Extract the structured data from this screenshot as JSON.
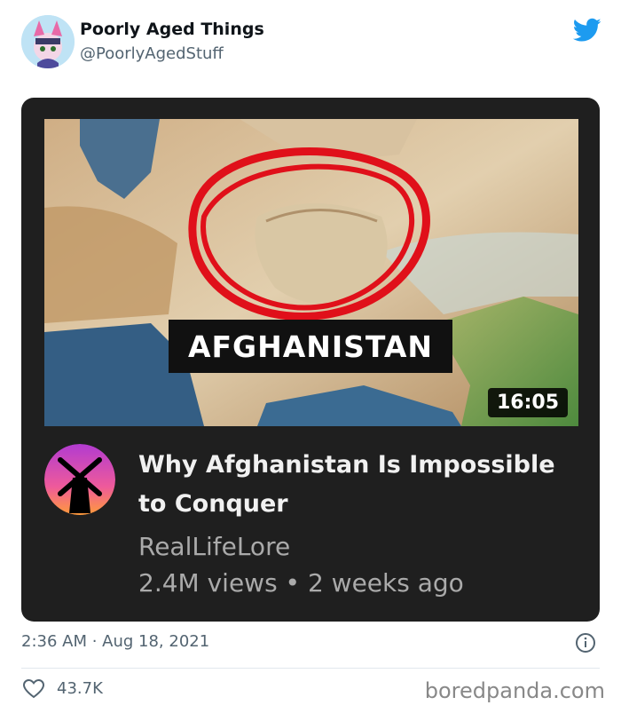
{
  "author": {
    "display_name": "Poorly Aged Things",
    "handle": "@PoorlyAgedStuff"
  },
  "video_card": {
    "thumbnail_label": "AFGHANISTAN",
    "duration": "16:05",
    "title": "Why Afghanistan Is Impossible to Conquer",
    "channel": "RealLifeLore",
    "meta": "2.4M views • 2 weeks ago"
  },
  "tweet": {
    "timestamp": "2:36 AM · Aug 18, 2021",
    "like_count": "43.7K"
  },
  "watermark": "boredpanda.com",
  "colors": {
    "twitter_blue": "#1d9bf0",
    "card_bg": "#1f1f1f",
    "circle_red": "#e0101a"
  }
}
